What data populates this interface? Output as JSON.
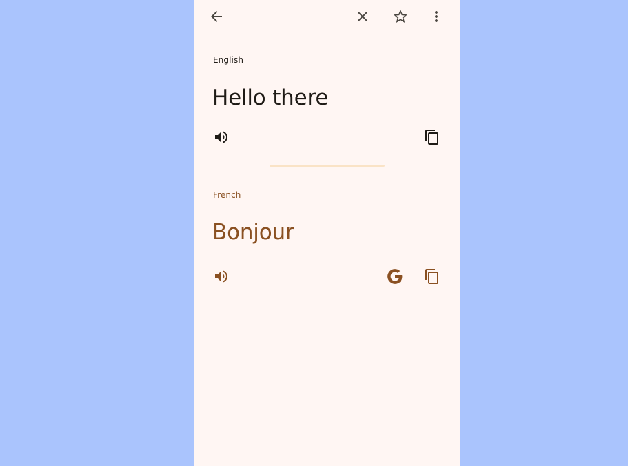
{
  "colors": {
    "backdrop": "#aac4fd",
    "surface": "#fff6f3",
    "source_text": "#1f1b16",
    "target_text": "#8a5021",
    "divider": "#fae3c6",
    "icon_dark": "#4a4640"
  },
  "toolbar": {
    "back_icon": "arrow-left-icon",
    "clear_icon": "close-icon",
    "favorite_icon": "star-outline-icon",
    "more_icon": "more-vert-icon"
  },
  "source": {
    "language": "English",
    "text": "Hello there",
    "speak_icon": "volume-up-icon",
    "copy_icon": "copy-icon"
  },
  "target": {
    "language": "French",
    "text": "Bonjour",
    "speak_icon": "volume-up-icon",
    "search_icon": "google-g-icon",
    "copy_icon": "copy-icon"
  }
}
